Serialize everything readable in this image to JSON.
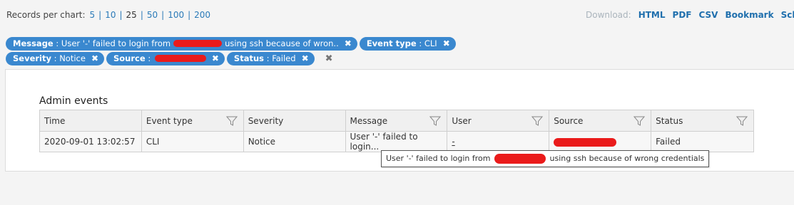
{
  "records": {
    "label": "Records per chart:",
    "options": [
      "5",
      "10",
      "25",
      "50",
      "100",
      "200"
    ],
    "selected": "25"
  },
  "download": {
    "label": "Download:",
    "links": [
      "HTML",
      "PDF",
      "CSV",
      "Bookmark",
      "Schedul"
    ]
  },
  "filters": [
    {
      "key": "Message",
      "value": "User '-' failed to login from",
      "value_tail": "using ssh because of wron.."
    },
    {
      "key": "Event type",
      "value": "CLI"
    },
    {
      "key": "Severity",
      "value": "Notice"
    },
    {
      "key": "Source",
      "value": ""
    },
    {
      "key": "Status",
      "value": "Failed"
    }
  ],
  "panel": {
    "title": "Admin events",
    "columns": [
      "Time",
      "Event type",
      "Severity",
      "Message",
      "User",
      "Source",
      "Status"
    ],
    "rows": [
      {
        "time": "2020-09-01 13:02:57",
        "event_type": "CLI",
        "severity": "Notice",
        "message": "User '-' failed to login...",
        "user": "-",
        "source": "",
        "status": "Failed"
      }
    ]
  },
  "tooltip": {
    "prefix": "User '-' failed to login from",
    "suffix": "using ssh because of wrong credentials"
  },
  "colors": {
    "chip": "#3a88cf",
    "link": "#2a7ab8",
    "redaction": "#ea1b1b"
  },
  "icons": {
    "filter": "funnel-icon",
    "remove": "close-icon"
  }
}
